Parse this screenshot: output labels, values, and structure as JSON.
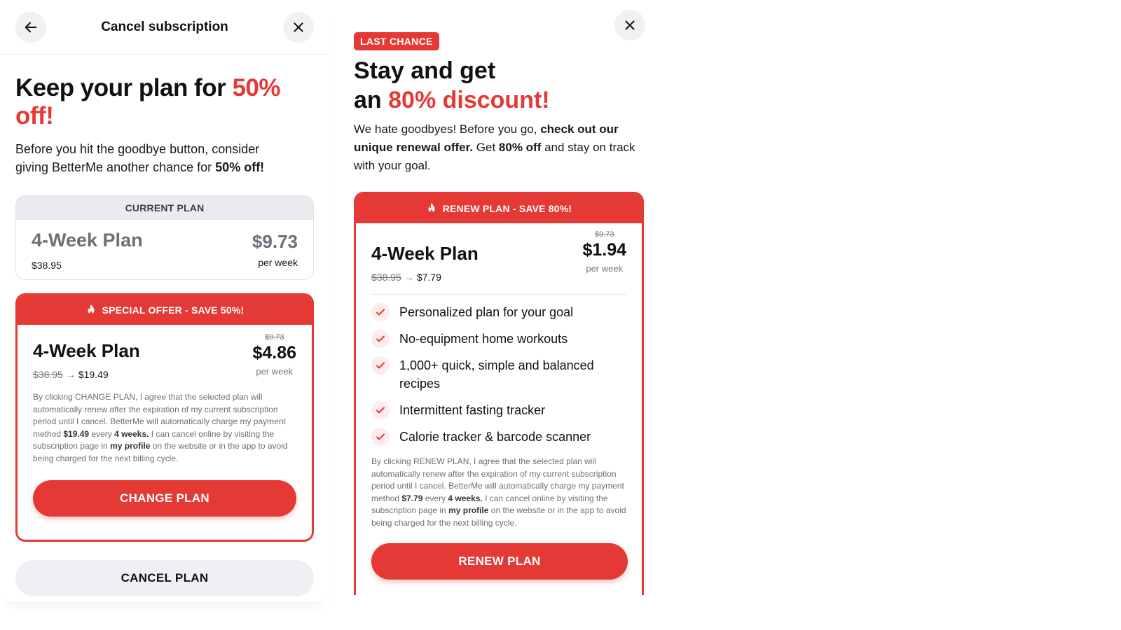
{
  "left": {
    "header": {
      "title": "Cancel subscription",
      "back_icon": "arrow-left-icon",
      "close_icon": "close-icon"
    },
    "heading": {
      "main": "Keep your plan for ",
      "accent": "50% off!"
    },
    "description": {
      "text": "Before you hit the goodbye button, consider giving BetterMe another chance for ",
      "bold": "50% off!"
    },
    "current_plan": {
      "label": "CURRENT PLAN",
      "name": "4-Week Plan",
      "total": "$38.95",
      "price": "$9.73",
      "per": "per week"
    },
    "offer": {
      "banner": "SPECIAL OFFER - SAVE 50%!",
      "name": "4-Week Plan",
      "old_total": "$38.95",
      "arrow": "→",
      "new_total": "$19.49",
      "old_price": "$9.73",
      "price": "$4.86",
      "per": "per week",
      "fine": {
        "p1": "By clicking CHANGE PLAN, I agree that the selected plan will automatically renew after the expiration of my current subscription period until I cancel. BetterMe will automatically charge my payment method ",
        "b1": "$19.49",
        "p2": " every ",
        "b2": "4 weeks.",
        "p3": " I can cancel online by visiting the subscription page in ",
        "b3": "my profile",
        "p4": " on the website or in the app to avoid being charged for the next billing cycle."
      },
      "button": "CHANGE PLAN"
    },
    "cancel_button": "CANCEL PLAN"
  },
  "right": {
    "close_icon": "close-icon",
    "badge": "LAST CHANCE",
    "heading": {
      "line1": "Stay and get",
      "line2_plain": "an ",
      "accent": "80% discount!"
    },
    "description": {
      "p1": "We hate goodbyes! Before you go, ",
      "b1": "check out our unique renewal offer.",
      "p2": " Get ",
      "b2": "80% off",
      "p3": " and stay on track with your goal."
    },
    "offer": {
      "banner": "RENEW PLAN - SAVE 80%!",
      "name": "4-Week Plan",
      "old_total": "$38.95",
      "arrow": "→",
      "new_total": "$7.79",
      "old_price": "$9.73",
      "price": "$1.94",
      "per": "per week",
      "features": [
        "Personalized plan for your goal",
        "No-equipment home workouts",
        "1,000+ quick, simple and balanced recipes",
        "Intermittent fasting tracker",
        "Calorie tracker & barcode scanner"
      ],
      "fine": {
        "p1": "By clicking RENEW PLAN, I agree that the selected plan will automatically renew after the expiration of my current subscription period until I cancel. BetterMe will automatically charge my payment method ",
        "b1": "$7.79",
        "p2": " every ",
        "b2": "4 weeks.",
        "p3": " I can cancel online by visiting the subscription page in ",
        "b3": "my profile",
        "p4": " on the website or in the app to avoid being charged for the next billing cycle."
      },
      "button": "RENEW PLAN"
    }
  },
  "colors": {
    "accent": "#e53935",
    "muted": "#6b6f78",
    "chip": "#f0f1f3"
  }
}
